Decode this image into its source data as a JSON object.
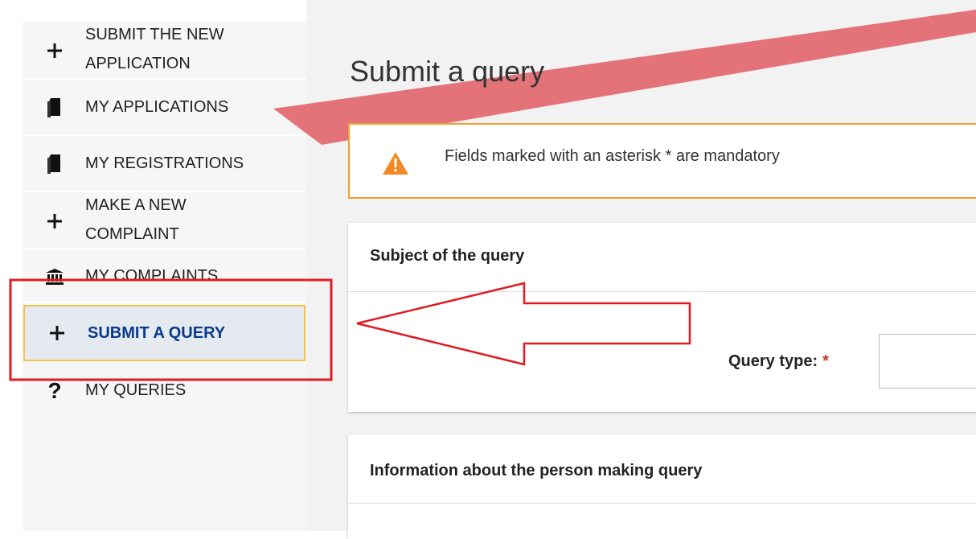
{
  "sidebar": {
    "items": [
      {
        "label_line1": "SUBMIT THE NEW",
        "label_line2": "APPLICATION",
        "icon": "plus-icon"
      },
      {
        "label": "MY APPLICATIONS",
        "icon": "document-icon"
      },
      {
        "label": "MY REGISTRATIONS",
        "icon": "document-icon"
      },
      {
        "label_line1": "MAKE A NEW",
        "label_line2": "COMPLAINT",
        "icon": "plus-icon"
      },
      {
        "label": "MY COMPLAINTS",
        "icon": "institution-icon"
      },
      {
        "label": "SUBMIT A QUERY",
        "icon": "plus-icon",
        "active": true
      },
      {
        "label": "MY QUERIES",
        "icon": "question-icon"
      }
    ]
  },
  "main": {
    "title": "Submit a query",
    "notice": "Fields marked with an asterisk * are mandatory",
    "panels": [
      {
        "title": "Subject of the query",
        "field_label": "Query type:",
        "required_mark": "*"
      },
      {
        "title": "Information about the person making query"
      }
    ]
  },
  "colors": {
    "accent_blue": "#0a3a8c",
    "active_border": "#f2c44b",
    "warning_border": "#f0a030",
    "annotation_red": "#e01b22",
    "annotation_stripe": "#e36a72"
  }
}
